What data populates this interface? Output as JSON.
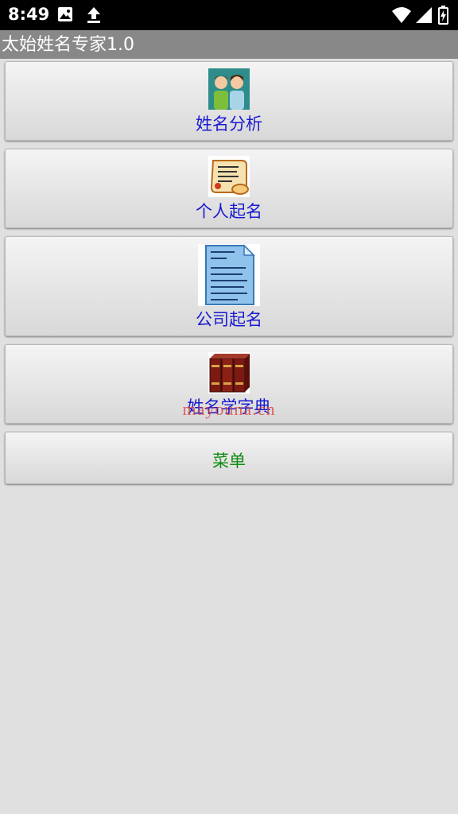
{
  "status_bar": {
    "time": "8:49",
    "icons": [
      "image-icon",
      "upload-icon",
      "wifi-icon",
      "signal-icon",
      "battery-icon"
    ]
  },
  "app": {
    "title": "太始姓名专家1.0"
  },
  "menu": {
    "items": [
      {
        "label": "姓名分析",
        "icon": "people-icon"
      },
      {
        "label": "个人起名",
        "icon": "scroll-icon"
      },
      {
        "label": "公司起名",
        "icon": "document-icon"
      },
      {
        "label": "姓名学字典",
        "icon": "books-icon"
      },
      {
        "label": "菜单"
      }
    ],
    "watermark": "mayouna.cn"
  },
  "colors": {
    "label_blue": "#1a1ad0",
    "label_green": "#138a13",
    "title_bar": "#888888",
    "background": "#e0e0e0"
  }
}
